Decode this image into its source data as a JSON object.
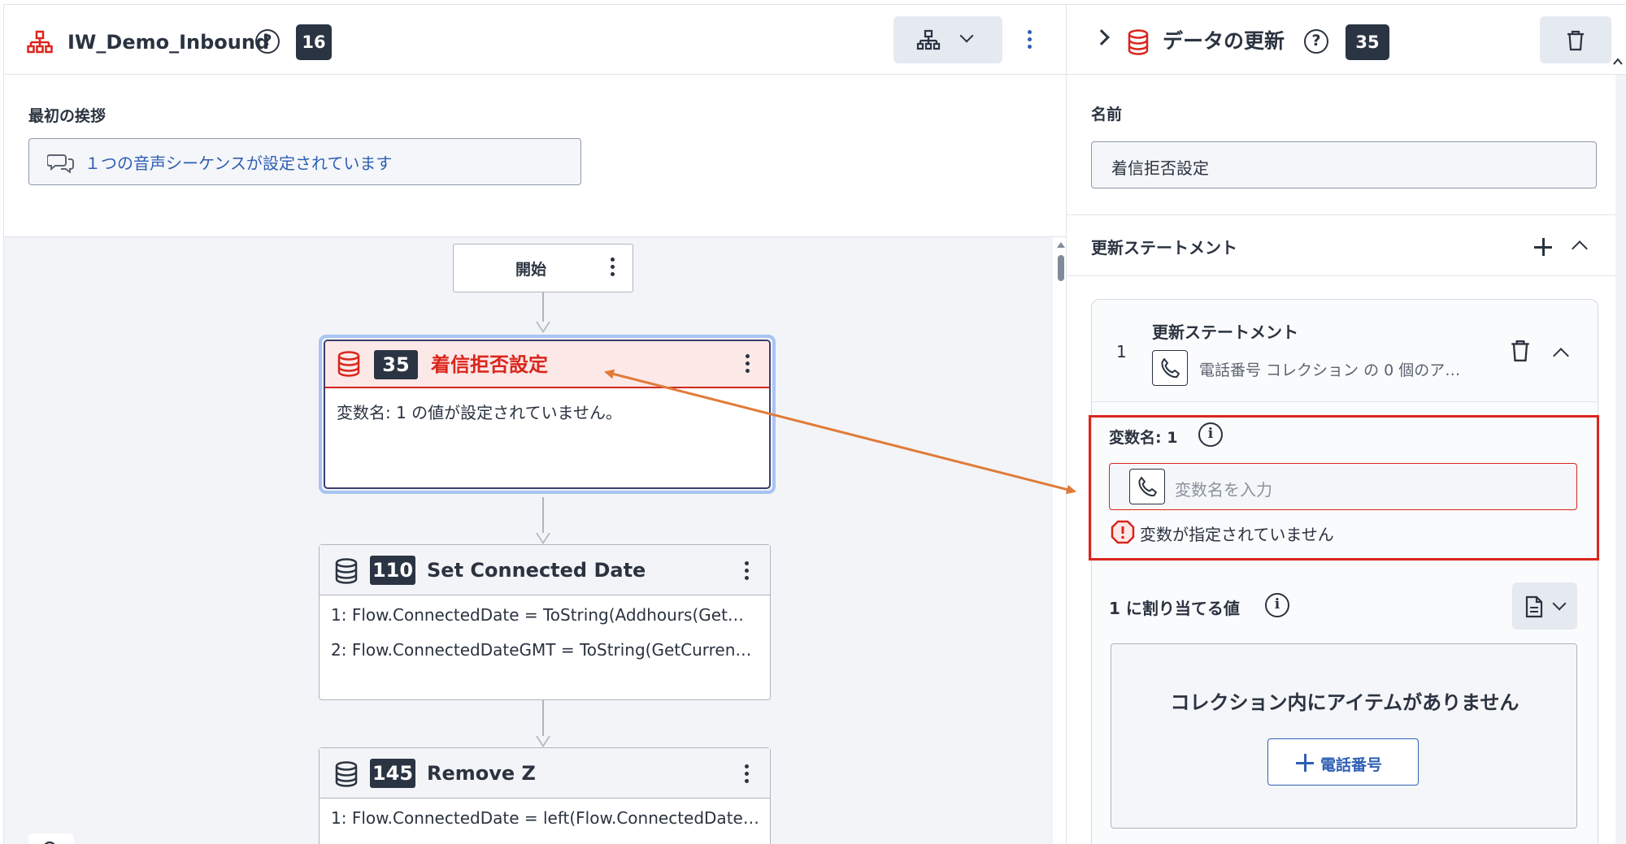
{
  "left_header": {
    "flow_name": "IW_Demo_Inbound",
    "help_glyph": "?",
    "flow_badge": "16",
    "icons": [
      "flow-hierarchy-icon",
      "help-icon",
      "layout-icon",
      "chevron-down-icon",
      "kebab-menu-icon"
    ]
  },
  "greeting": {
    "label": "最初の挨拶",
    "value": "１つの音声シーケンスが設定されています",
    "icon": "chat-bubbles-icon"
  },
  "canvas": {
    "start": {
      "label": "開始"
    },
    "nodes": [
      {
        "badge": "35",
        "title": "着信拒否設定",
        "lines": [
          "変数名: 1 の値が設定されていません。"
        ],
        "state": "error-selected",
        "icon": "database-icon"
      },
      {
        "badge": "110",
        "title": "Set Connected Date",
        "lines": [
          "1: Flow.ConnectedDate = ToString(Addhours(Get…",
          "2: Flow.ConnectedDateGMT = ToString(GetCurren…"
        ],
        "state": "normal",
        "icon": "database-icon"
      },
      {
        "badge": "145",
        "title": "Remove Z",
        "lines": [
          "1: Flow.ConnectedDate = left(Flow.ConnectedDate…"
        ],
        "state": "normal",
        "icon": "database-icon"
      }
    ]
  },
  "right_panel": {
    "title": "データの更新",
    "help_glyph": "?",
    "badge": "35",
    "name_label": "名前",
    "name_value": "着信拒否設定",
    "statements_label": "更新ステートメント",
    "statement": {
      "number": "1",
      "title": "更新ステートメント",
      "summary": "電話番号 コレクション の 0 個のア…",
      "variable_label": "変数名: 1",
      "info_glyph": "i",
      "variable_placeholder": "変数名を入力",
      "error_text": "変数が指定されていません",
      "assign_label": "1 に割り当てる値",
      "empty_text": "コレクション内にアイテムがありません",
      "add_button_label": "電話番号"
    },
    "icons": [
      "chevron-right-icon",
      "database-icon",
      "trash-icon",
      "plus-icon",
      "chevron-up-icon",
      "phone-icon",
      "info-icon",
      "error-icon",
      "document-icon"
    ]
  },
  "colors": {
    "accent_blue": "#2f5fb4",
    "error_red": "#d9261c",
    "badge_dark": "#2a3442",
    "annotation_arrow": "#e07b39"
  }
}
